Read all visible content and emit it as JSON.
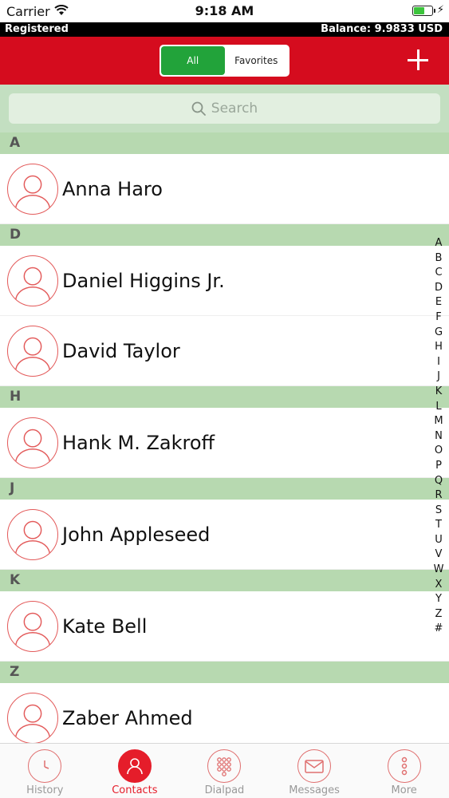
{
  "status_bar": {
    "carrier": "Carrier",
    "time": "9:18 AM",
    "battery_level": 0.55
  },
  "registration": {
    "status": "Registered",
    "balance": "Balance: 9.9833 USD"
  },
  "header": {
    "segments": [
      "All",
      "Favorites"
    ],
    "active_segment": "All",
    "add_icon": "plus-icon",
    "color": "#d50c1e"
  },
  "search": {
    "placeholder": "Search"
  },
  "contacts": {
    "sections": [
      {
        "letter": "A",
        "items": [
          "Anna Haro"
        ]
      },
      {
        "letter": "D",
        "items": [
          "Daniel Higgins Jr.",
          "David Taylor"
        ]
      },
      {
        "letter": "H",
        "items": [
          "Hank M. Zakroff"
        ]
      },
      {
        "letter": "J",
        "items": [
          "John Appleseed"
        ]
      },
      {
        "letter": "K",
        "items": [
          "Kate Bell"
        ]
      },
      {
        "letter": "Z",
        "items": [
          "Zaber Ahmed"
        ]
      }
    ]
  },
  "index_letters": [
    "A",
    "B",
    "C",
    "D",
    "E",
    "F",
    "G",
    "H",
    "I",
    "J",
    "K",
    "L",
    "M",
    "N",
    "O",
    "P",
    "Q",
    "R",
    "S",
    "T",
    "U",
    "V",
    "W",
    "X",
    "Y",
    "Z",
    "#"
  ],
  "tabbar": {
    "tabs": [
      {
        "label": "History",
        "icon": "clock-icon"
      },
      {
        "label": "Contacts",
        "icon": "person-icon"
      },
      {
        "label": "Dialpad",
        "icon": "dialpad-icon"
      },
      {
        "label": "Messages",
        "icon": "envelope-icon"
      },
      {
        "label": "More",
        "icon": "more-icon"
      }
    ],
    "active": "Contacts",
    "accent": "#e51d2a"
  }
}
